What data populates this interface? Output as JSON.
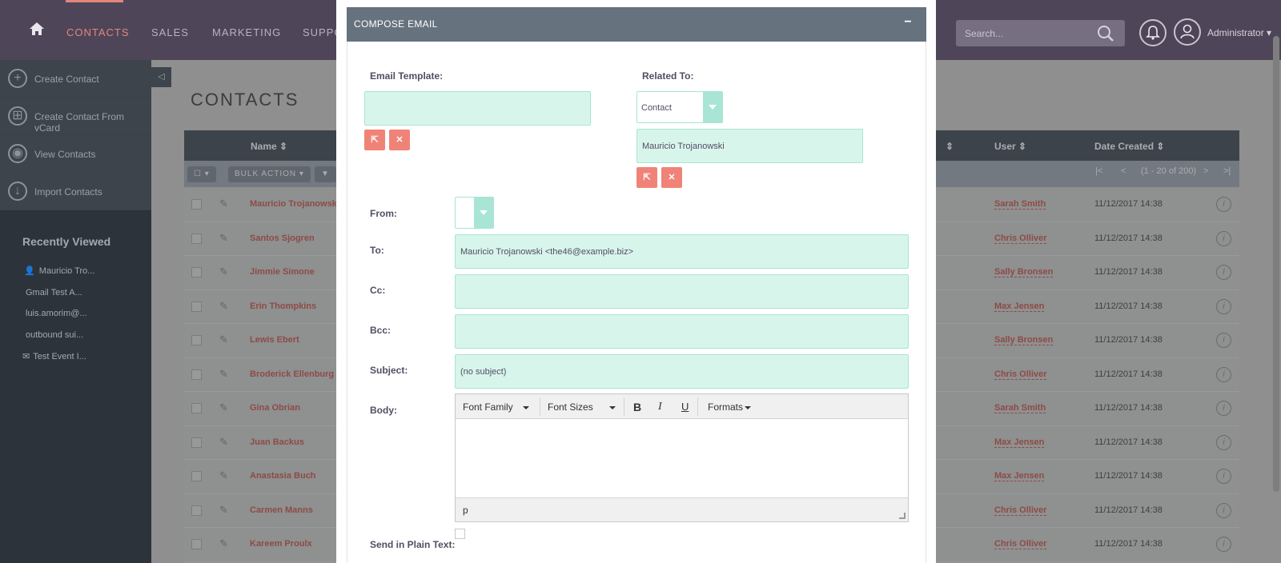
{
  "nav": {
    "items": [
      "CONTACTS",
      "SALES",
      "MARKETING",
      "SUPPO"
    ],
    "search_placeholder": "Search...",
    "user_label": "Administrator"
  },
  "sidebar": {
    "actions": [
      {
        "label": "Create Contact",
        "icon": "plus-circle-icon"
      },
      {
        "label": "Create Contact From vCard",
        "icon": "plus-square-icon"
      },
      {
        "label": "View Contacts",
        "icon": "eye-icon"
      },
      {
        "label": "Import Contacts",
        "icon": "download-arrow-icon"
      }
    ],
    "recent_title": "Recently Viewed",
    "recent": [
      "Mauricio Tro...",
      "Gmail Test A...",
      "luis.amorim@...",
      "outbound sui...",
      "Test Event I..."
    ]
  },
  "main": {
    "title": "CONTACTS",
    "columns": {
      "name": "Name",
      "user": "User",
      "date_created": "Date Created"
    },
    "bulk_action": "BULK ACTION",
    "pagination": "(1 - 20 of 200)",
    "rows": [
      {
        "name": "Mauricio Trojanowski",
        "user": "Sarah Smith",
        "date": "11/12/2017 14:38"
      },
      {
        "name": "Santos Sjogren",
        "user": "Chris Olliver",
        "date": "11/12/2017 14:38"
      },
      {
        "name": "Jimmie Simone",
        "user": "Sally Bronsen",
        "date": "11/12/2017 14:38"
      },
      {
        "name": "Erin Thompkins",
        "user": "Max Jensen",
        "date": "11/12/2017 14:38"
      },
      {
        "name": "Lewis Ebert",
        "user": "Sally Bronsen",
        "date": "11/12/2017 14:38"
      },
      {
        "name": "Broderick Ellenburg",
        "user": "Chris Olliver",
        "date": "11/12/2017 14:38"
      },
      {
        "name": "Gina Obrian",
        "user": "Sarah Smith",
        "date": "11/12/2017 14:38"
      },
      {
        "name": "Juan Backus",
        "user": "Max Jensen",
        "date": "11/12/2017 14:38"
      },
      {
        "name": "Anastasia Buch",
        "user": "Max Jensen",
        "date": "11/12/2017 14:38"
      },
      {
        "name": "Carmen Manns",
        "user": "Chris Olliver",
        "date": "11/12/2017 14:38"
      },
      {
        "name": "Kareem Proulx",
        "user": "Chris Olliver",
        "date": "11/12/2017 14:38"
      }
    ]
  },
  "modal": {
    "title": "COMPOSE EMAIL",
    "collapse": "−",
    "email_template_label": "Email Template:",
    "email_template_value": "",
    "related_to_label": "Related To:",
    "related_to_type": "Contact",
    "related_to_name": "Mauricio Trojanowski",
    "from_label": "From:",
    "from_value": "",
    "to_label": "To:",
    "to_value": "Mauricio Trojanowski <the46@example.biz>",
    "cc_label": "Cc:",
    "cc_value": "",
    "bcc_label": "Bcc:",
    "bcc_value": "",
    "subject_label": "Subject:",
    "subject_value": "(no subject)",
    "body_label": "Body:",
    "editor": {
      "font_family": "Font Family",
      "font_sizes": "Font Sizes",
      "bold": "B",
      "italic": "I",
      "underline": "U",
      "formats": "Formats",
      "status_path": "p"
    },
    "plain_text_label": "Send in Plain Text:"
  },
  "colors": {
    "nav_bg": "#4e4658",
    "accent": "#e4857c",
    "field_bg": "#d8f5ec",
    "field_border": "#a7e5d2",
    "danger_button": "#f08377",
    "modal_header": "#66727e"
  }
}
